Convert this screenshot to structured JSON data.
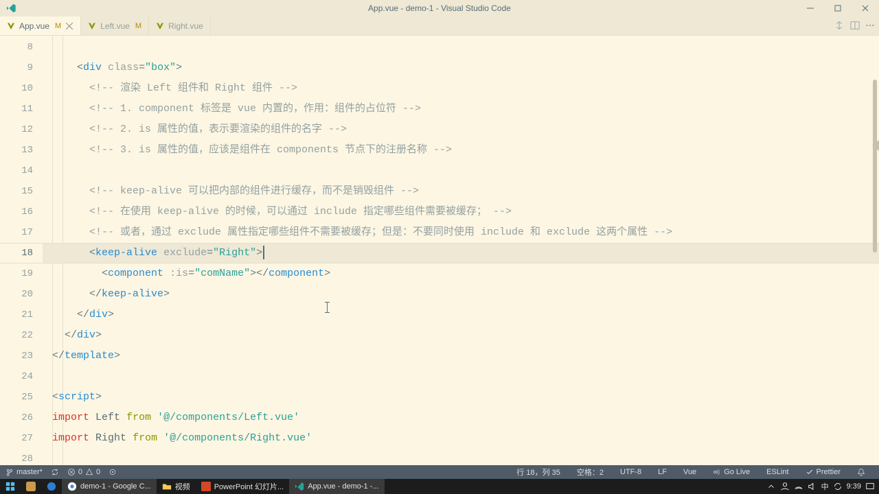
{
  "window": {
    "title": "App.vue - demo-1 - Visual Studio Code"
  },
  "tabs": {
    "items": [
      {
        "name": "App.vue",
        "mod": "M",
        "active": true
      },
      {
        "name": "Left.vue",
        "mod": "M",
        "active": false
      },
      {
        "name": "Right.vue",
        "mod": "",
        "active": false
      }
    ]
  },
  "editor": {
    "first_line": 8,
    "active_line": 18,
    "lines": [
      "",
      "    <div class=\"box\">",
      "      <!-- 渲染 Left 组件和 Right 组件 -->",
      "      <!-- 1. component 标签是 vue 内置的，作用：组件的占位符 -->",
      "      <!-- 2. is 属性的值，表示要渲染的组件的名字 -->",
      "      <!-- 3. is 属性的值，应该是组件在 components 节点下的注册名称 -->",
      "",
      "      <!-- keep-alive 可以把内部的组件进行缓存，而不是销毁组件 -->",
      "      <!-- 在使用 keep-alive 的时候，可以通过 include 指定哪些组件需要被缓存； -->",
      "      <!-- 或者，通过 exclude 属性指定哪些组件不需要被缓存；但是：不要同时使用 include 和 exclude 这两个属性 -->",
      "      <keep-alive exclude=\"Right\">",
      "        <component :is=\"comName\"></component>",
      "      </keep-alive>",
      "    </div>",
      "  </div>",
      "</template>",
      "",
      "<script>",
      "import Left from '@/components/Left.vue'",
      "import Right from '@/components/Right.vue'",
      ""
    ]
  },
  "status": {
    "branch": "master*",
    "sync": "↻",
    "errors": "0",
    "warnings": "0",
    "cursor": "行 18，列 35",
    "spaces": "空格：2",
    "encoding": "UTF-8",
    "eol": "LF",
    "lang": "Vue",
    "golive": "Go Live",
    "eslint": "ESLint",
    "prettier": "Prettier"
  },
  "taskbar": {
    "items": [
      {
        "label": "demo-1 - Google C..."
      },
      {
        "label": "视频"
      },
      {
        "label": "PowerPoint 幻灯片..."
      },
      {
        "label": "App.vue - demo-1 -..."
      }
    ],
    "tray": {
      "ime": "中",
      "time": "9:39"
    }
  }
}
